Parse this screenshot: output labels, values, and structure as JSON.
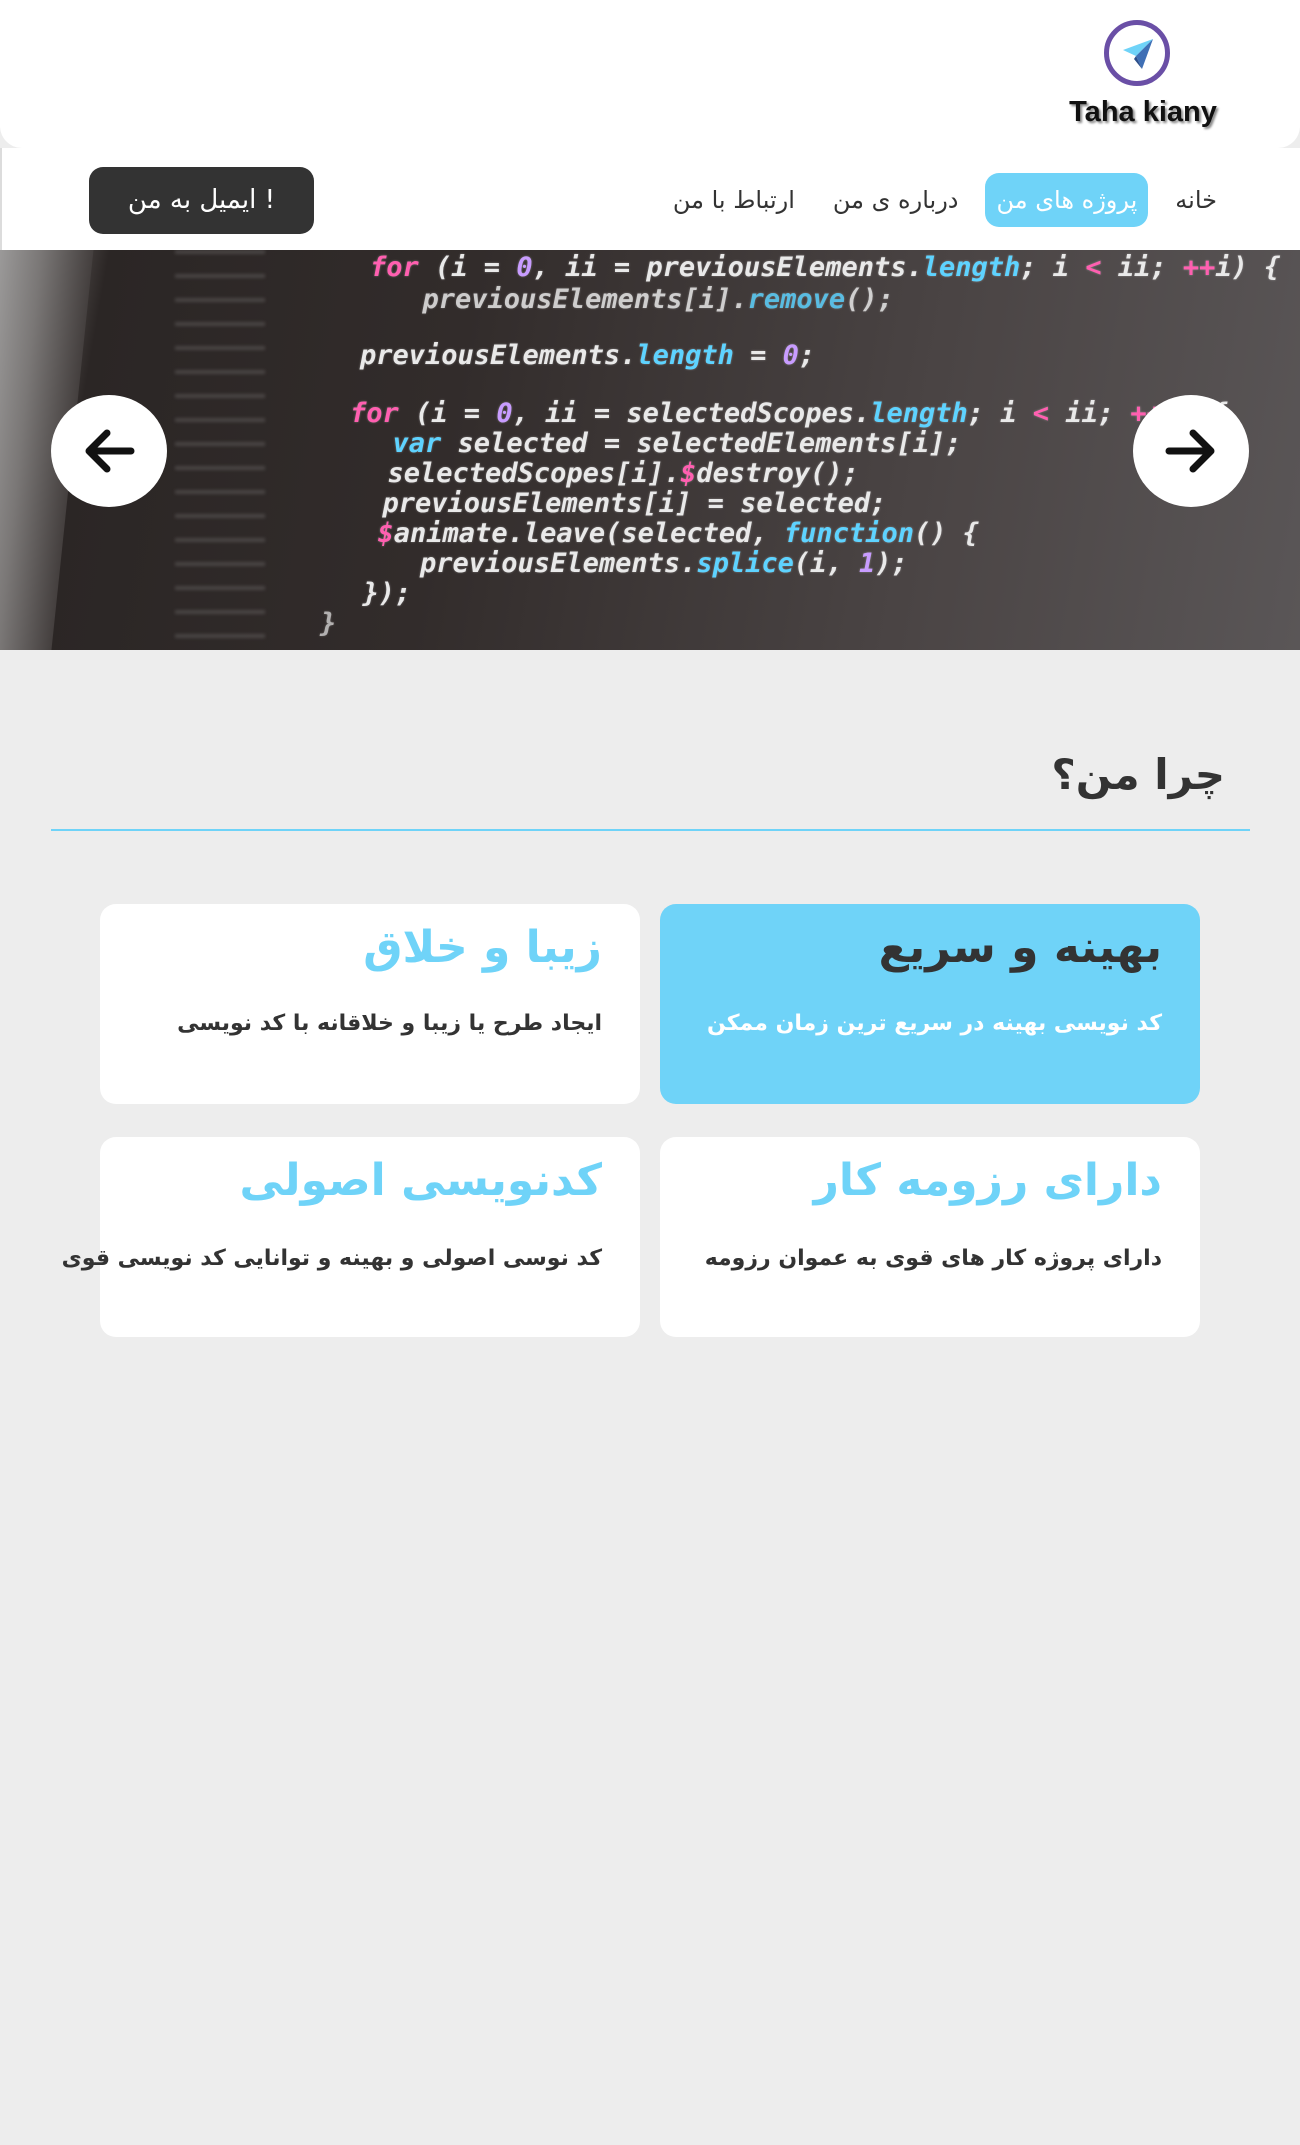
{
  "header": {
    "logo_text": "Taha kiany",
    "logo_icon": "send-icon"
  },
  "nav": {
    "items": [
      {
        "label": "خانه",
        "active": false
      },
      {
        "label": "پروژه های من",
        "active": true
      },
      {
        "label": "درباره ی من",
        "active": false
      },
      {
        "label": "ارتباط با من",
        "active": false
      }
    ],
    "email_button": "ایمیل به من !"
  },
  "slider": {
    "prev_icon": "arrow-left-icon",
    "next_icon": "arrow-right-icon"
  },
  "why": {
    "title": "چرا من؟",
    "cards": [
      {
        "title": "بهینه و سریع",
        "desc": "کد نویسی بهینه در سریع ترین زمان ممکن",
        "highlighted": true
      },
      {
        "title": "زیبا و خلاق",
        "desc": "ایجاد طرح یا زیبا و خلاقانه با کد نویسی",
        "highlighted": false
      },
      {
        "title": "دارای رزومه کار",
        "desc": "دارای پروژه کار های قوی به عموان رزومه",
        "highlighted": false
      },
      {
        "title": "کدنویسی اصولی",
        "desc": "کد نوسی اصولی و بهینه و توانایی کد نویسی قوی",
        "highlighted": false
      }
    ]
  },
  "colors": {
    "accent": "#6fd3f8",
    "dark": "#333333",
    "background": "#ededed",
    "logo_ring": "#6a4fa6"
  }
}
